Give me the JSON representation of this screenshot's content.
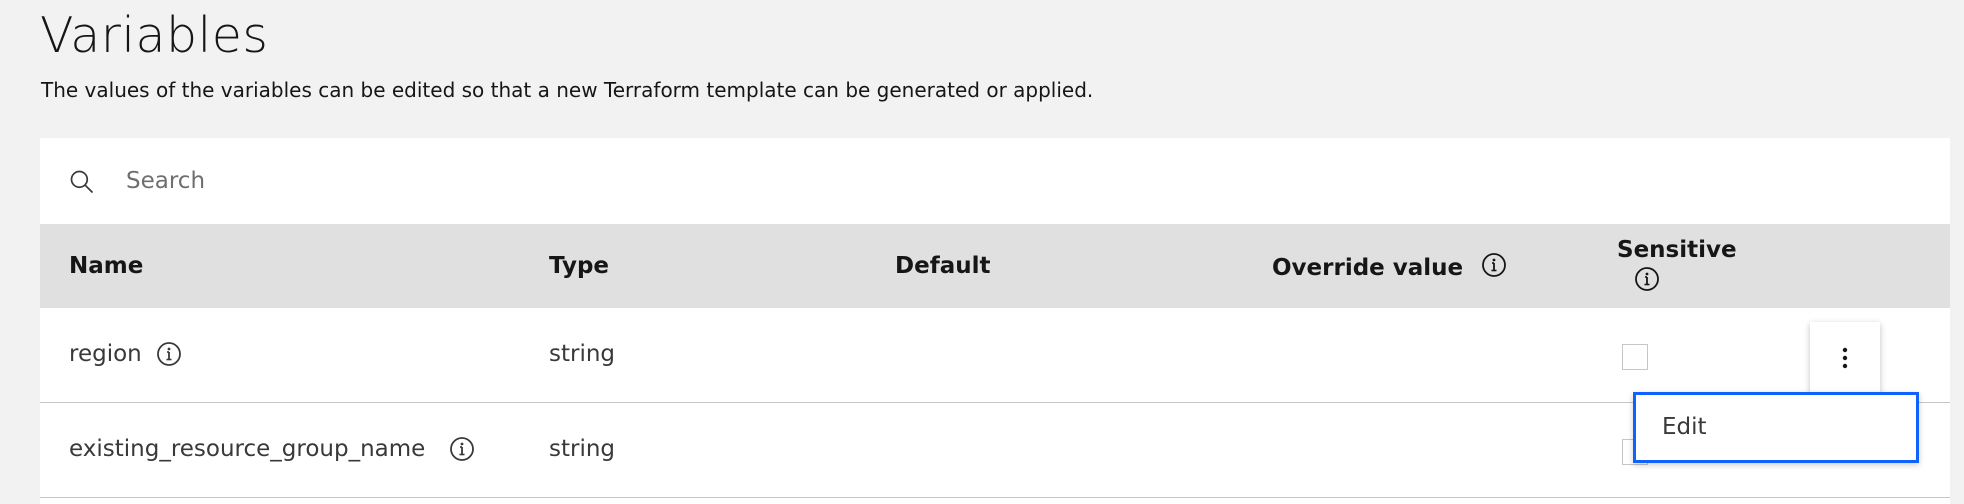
{
  "header": {
    "title": "Variables",
    "description": "The values of the variables can be edited so that a new Terraform template can be generated or applied."
  },
  "search": {
    "placeholder": "Search",
    "value": ""
  },
  "table": {
    "headers": {
      "name": "Name",
      "type": "Type",
      "default": "Default",
      "override": "Override value",
      "sensitive": "Sensitive"
    },
    "rows": [
      {
        "name": "region",
        "type": "string",
        "default": "",
        "override": "",
        "sensitive": false
      },
      {
        "name": "existing_resource_group_name",
        "type": "string",
        "default": "",
        "override": "",
        "sensitive": false
      }
    ]
  },
  "overflow_menu": {
    "items": [
      {
        "label": "Edit"
      }
    ]
  },
  "colors": {
    "background": "#f2f2f2",
    "header_bg": "#e0e0e0",
    "focus": "#0f62fe",
    "text": "#161616"
  },
  "icons": {
    "search": "search-icon",
    "info": "information-icon",
    "overflow": "overflow-menu-vertical-icon"
  }
}
